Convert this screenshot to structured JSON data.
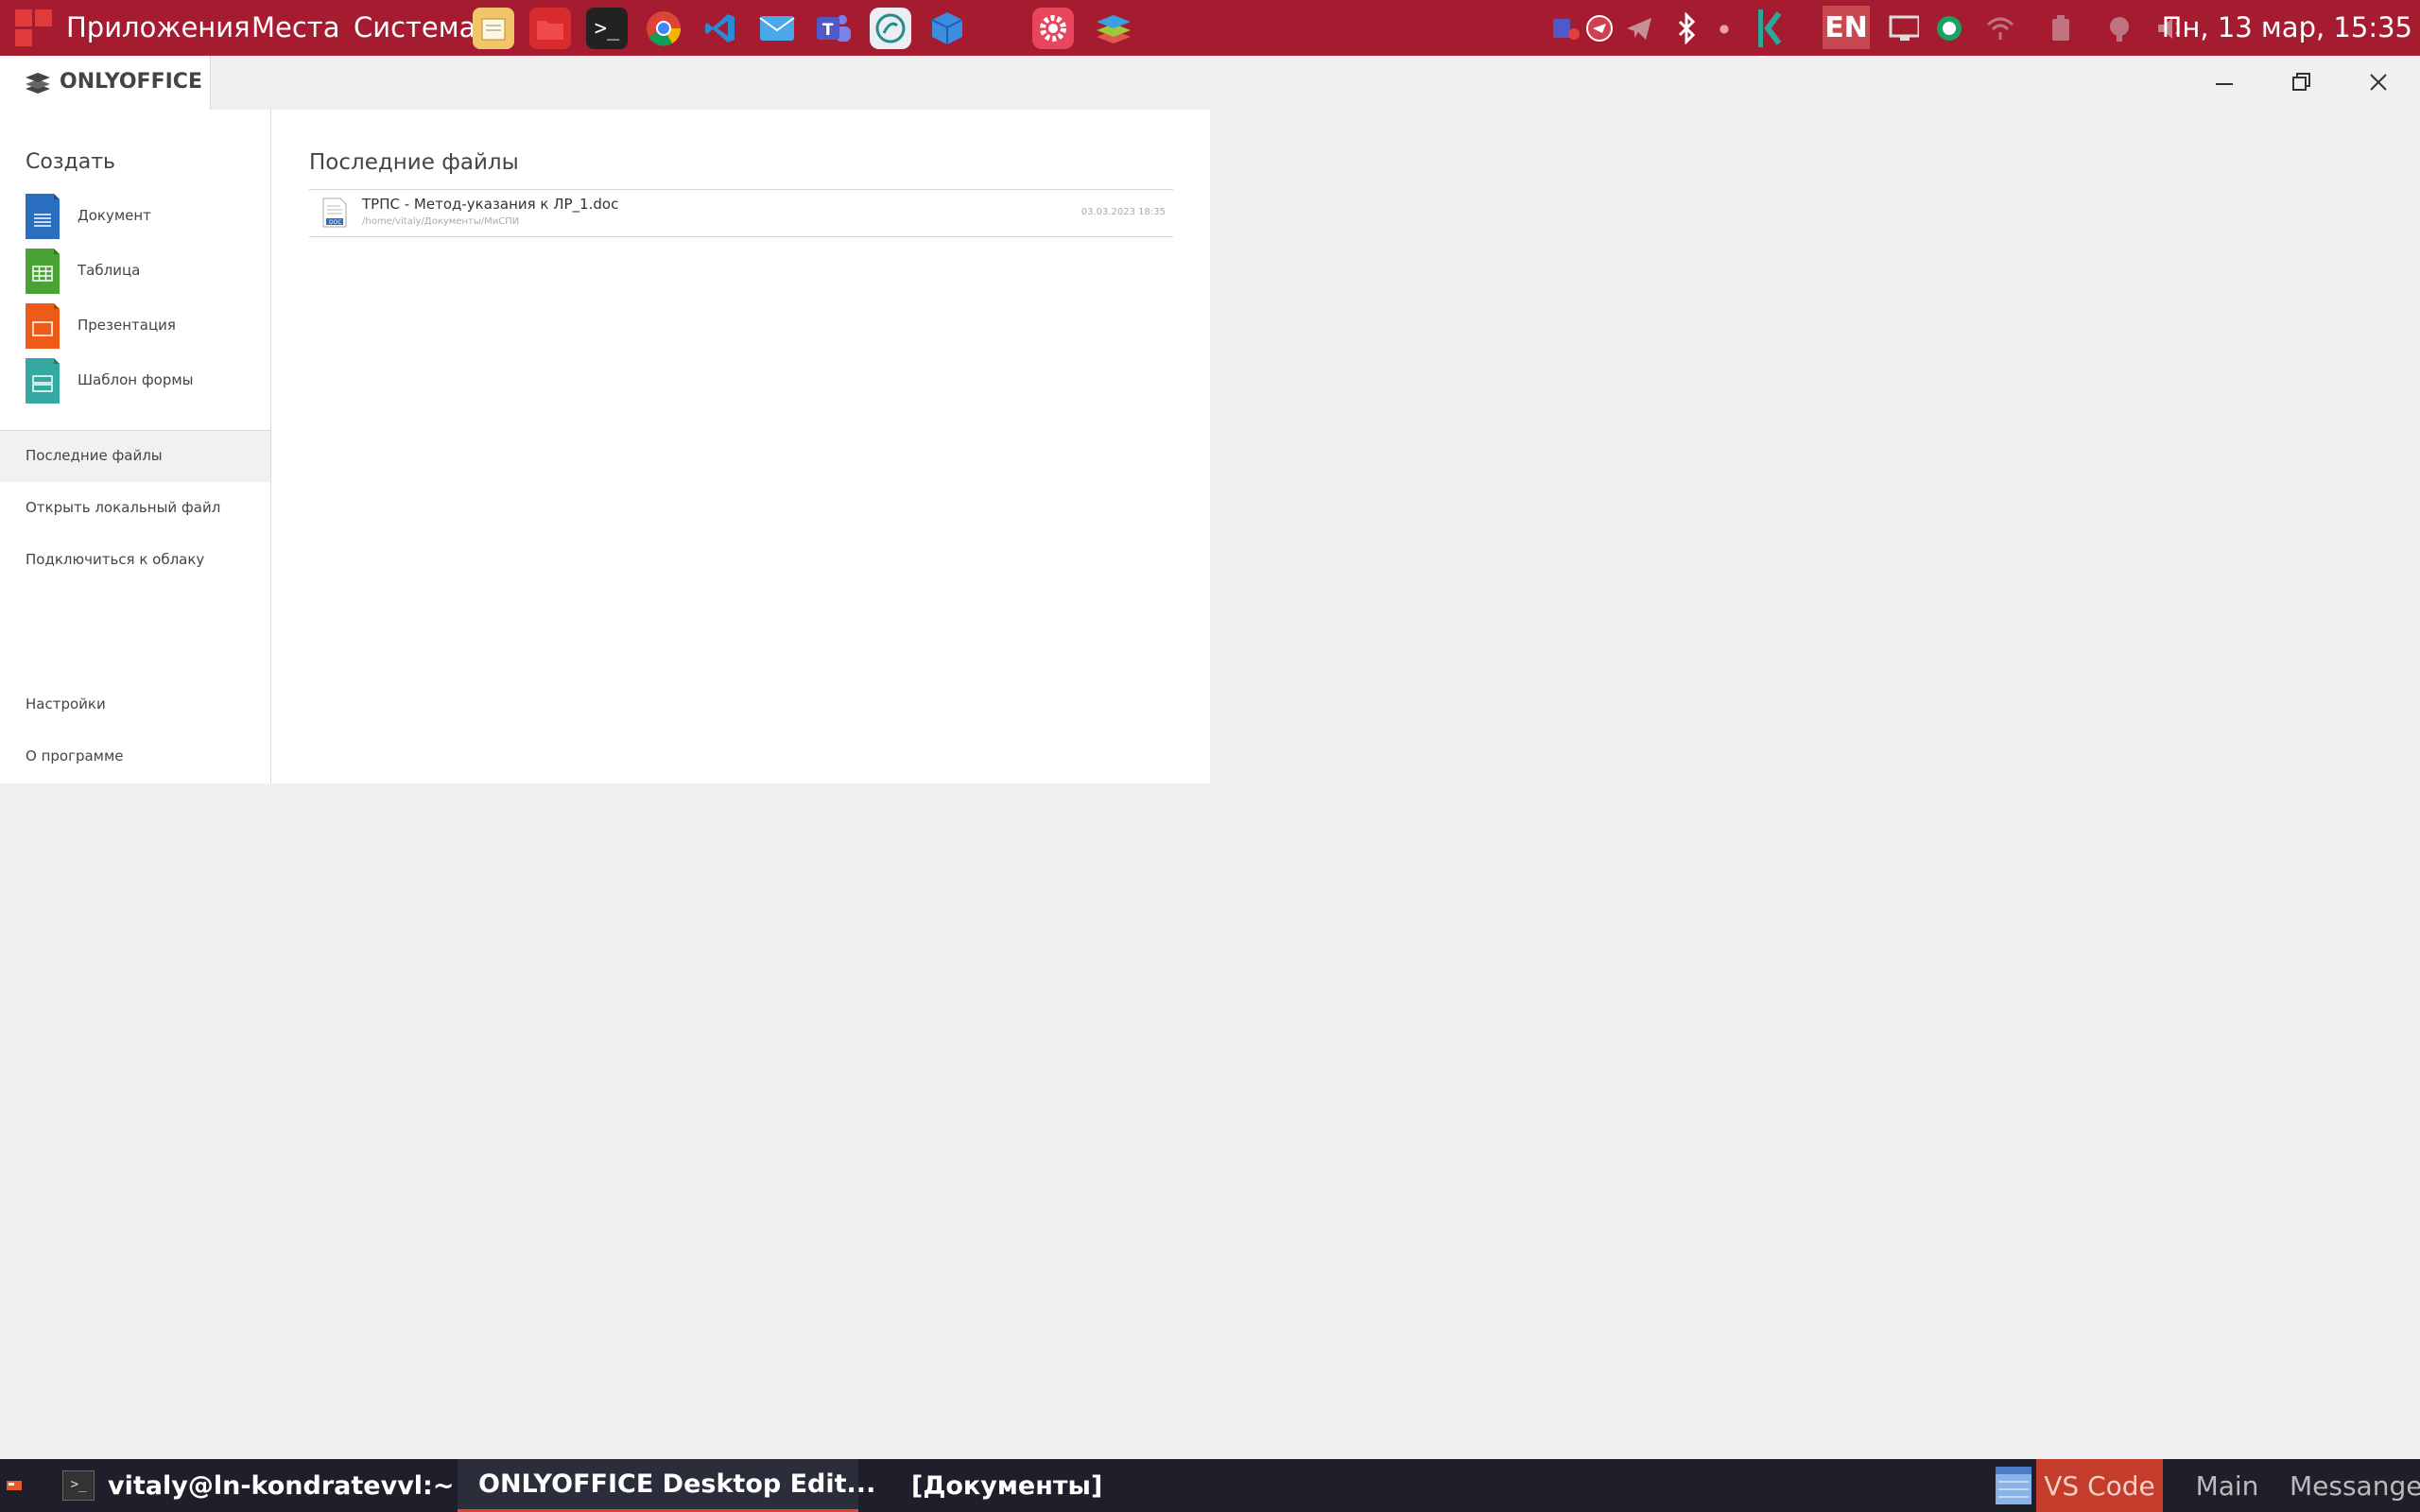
{
  "top_panel": {
    "menu": [
      "Приложения",
      "Места",
      "Система"
    ],
    "launchers": [
      "notepad-icon",
      "folder-icon",
      "terminal-icon",
      "chrome-icon",
      "vscode-icon",
      "mail-icon",
      "teams-icon",
      "remote-desktop-icon",
      "cube-icon",
      "settings-icon",
      "onlyoffice-icon"
    ],
    "language": "EN",
    "clock": "Пн, 13 мар, 15:35"
  },
  "window": {
    "app_name": "ONLYOFFICE",
    "controls": [
      "minimize-icon",
      "restore-icon",
      "close-icon"
    ]
  },
  "sidebar": {
    "create_title": "Создать",
    "create_items": [
      {
        "label": "Документ",
        "color": "#2a6ebf"
      },
      {
        "label": "Таблица",
        "color": "#4aa335"
      },
      {
        "label": "Презентация",
        "color": "#ee5a17"
      },
      {
        "label": "Шаблон формы",
        "color": "#34a99f"
      }
    ],
    "nav": [
      {
        "label": "Последние файлы",
        "active": true
      },
      {
        "label": "Открыть локальный файл"
      },
      {
        "label": "Подключиться к облаку"
      }
    ],
    "bottom": [
      "Настройки",
      "О программе"
    ]
  },
  "recent": {
    "title": "Последние файлы",
    "files": [
      {
        "name": "ТРПС - Метод-указания к ЛР_1.doc",
        "path": "/home/vitaly/Документы/МиСПИ",
        "date": "03.03.2023 18:35",
        "type": "DOC"
      }
    ]
  },
  "taskbar": {
    "items": [
      {
        "label": "vitaly@ln-kondratevvl:~"
      },
      {
        "label": "ONLYOFFICE Desktop Edit..."
      },
      {
        "label": "[Документы]"
      }
    ],
    "workspaces": [
      "VS Code",
      "Main",
      "Messanger"
    ]
  }
}
